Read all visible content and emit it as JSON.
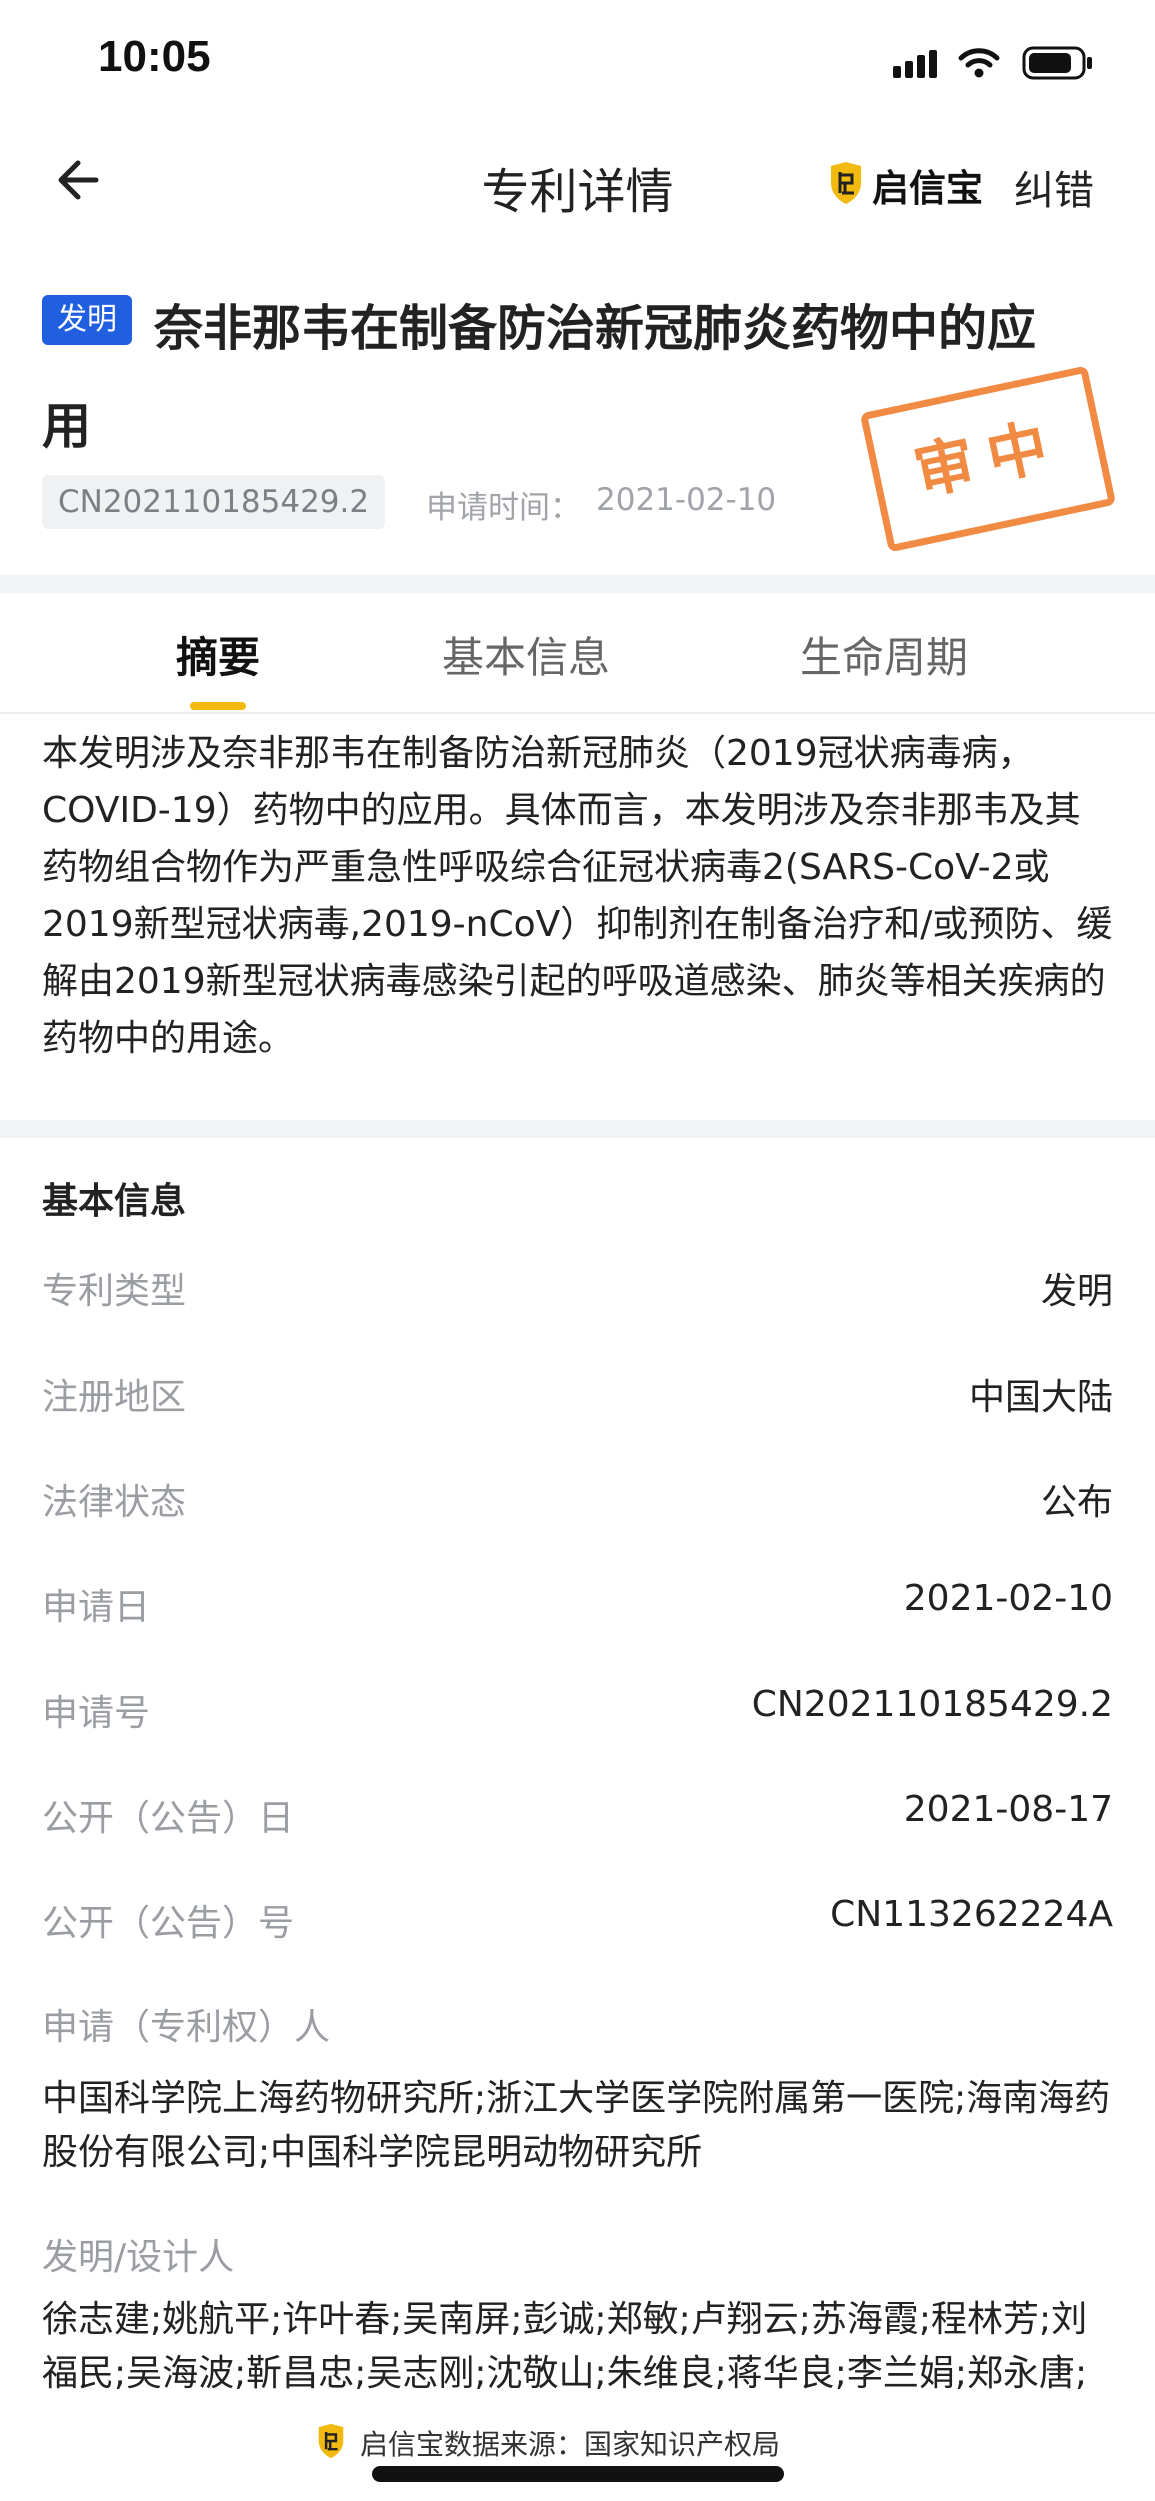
{
  "status_bar": {
    "time": "10:05"
  },
  "nav": {
    "title": "专利详情",
    "brand_name": "启信宝",
    "report_error": "纠错"
  },
  "patent": {
    "type_badge": "发明",
    "title": "奈非那韦在制备防治新冠肺炎药物中的应用",
    "stamp": "审中",
    "number": "CN202110185429.2",
    "application_date_label": "申请时间：",
    "application_date": "2021-02-10"
  },
  "tabs": [
    {
      "label": "摘要"
    },
    {
      "label": "基本信息"
    },
    {
      "label": "生命周期"
    }
  ],
  "abstract": "本发明涉及奈非那韦在制备防治新冠肺炎（2019冠状病毒病，COVID-19）药物中的应用。具体而言，本发明涉及奈非那韦及其药物组合物作为严重急性呼吸综合征冠状病毒2(SARS-CoV-2或2019新型冠状病毒,2019-nCoV）抑制剂在制备治疗和/或预防、缓解由2019新型冠状病毒感染引起的呼吸道感染、肺炎等相关疾病的药物中的用途。",
  "basic_info": {
    "heading": "基本信息",
    "rows": [
      {
        "label": "专利类型",
        "value": "发明"
      },
      {
        "label": "注册地区",
        "value": "中国大陆"
      },
      {
        "label": "法律状态",
        "value": "公布"
      },
      {
        "label": "申请日",
        "value": "2021-02-10"
      },
      {
        "label": "申请号",
        "value": "CN202110185429.2"
      },
      {
        "label": "公开（公告）日",
        "value": "2021-08-17"
      },
      {
        "label": "公开（公告）号",
        "value": "CN113262224A"
      }
    ],
    "applicant_label": "申请（专利权）人",
    "applicants": "中国科学院上海药物研究所;浙江大学医学院附属第一医院;海南海药股份有限公司;中国科学院昆明动物研究所",
    "inventor_label": "发明/设计人",
    "inventors": "徐志建;姚航平;许叶春;吴南屏;彭诚;郑敏;卢翔云;苏海霞;程林芳;刘福民;吴海波;靳昌忠;吴志刚;沈敬山;朱维良;蒋华良;李兰娟;郑永唐;魏晓军;高颖;潘小燕;刘刚;朱国全;宋丽华"
  },
  "footer": {
    "text": "启信宝数据来源：国家知识产权局"
  },
  "colors": {
    "accent": "#f2b90f",
    "badge_blue": "#1f5fe0",
    "stamp_orange": "#f07a2a"
  }
}
